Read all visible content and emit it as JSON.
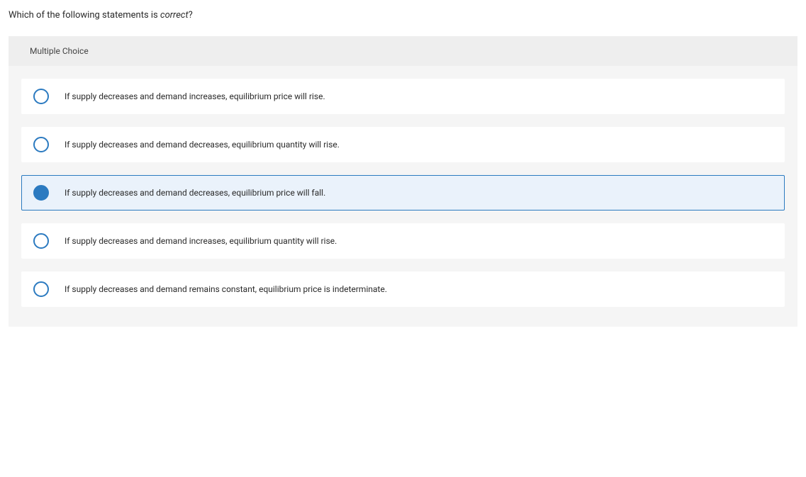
{
  "question": {
    "prefix": "Which of the following statements is ",
    "italic_word": "correct",
    "suffix": "?"
  },
  "section_title": "Multiple Choice",
  "options": [
    {
      "label": "If supply decreases and demand increases, equilibrium price will rise.",
      "selected": false
    },
    {
      "label": "If supply decreases and demand decreases, equilibrium quantity will rise.",
      "selected": false
    },
    {
      "label": "If supply decreases and demand decreases, equilibrium price will fall.",
      "selected": true
    },
    {
      "label": "If supply decreases and demand increases, equilibrium quantity will rise.",
      "selected": false
    },
    {
      "label": "If supply decreases and demand remains constant, equilibrium price is indeterminate.",
      "selected": false
    }
  ]
}
